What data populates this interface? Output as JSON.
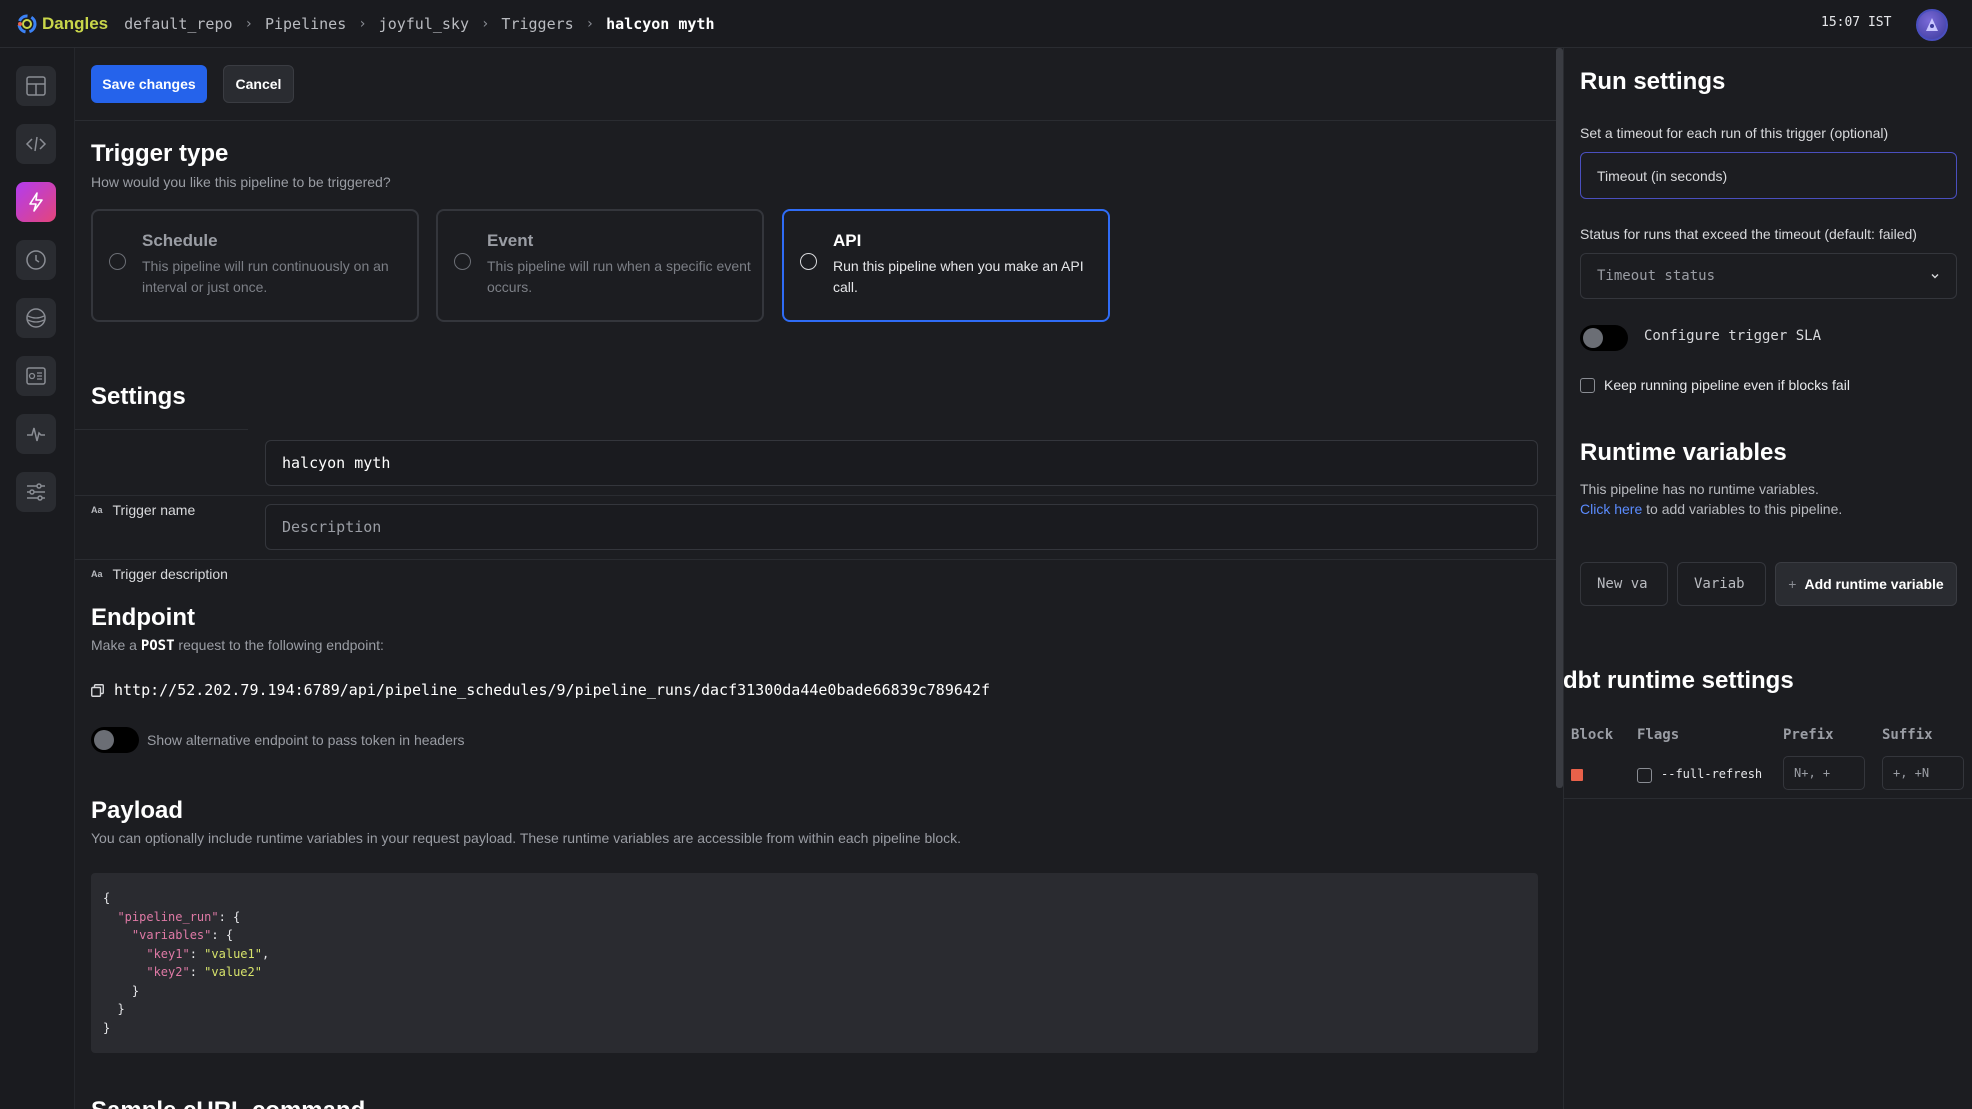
{
  "header": {
    "app_name": "Dangles",
    "breadcrumbs": [
      "default_repo",
      "Pipelines",
      "joyful_sky",
      "Triggers"
    ],
    "current": "halcyon myth",
    "time": "15:07 IST"
  },
  "toolbar": {
    "save_label": "Save changes",
    "cancel_label": "Cancel"
  },
  "trigger_type": {
    "title": "Trigger type",
    "subtitle": "How would you like this pipeline to be triggered?",
    "options": [
      {
        "title": "Schedule",
        "desc": "This pipeline will run continuously on an interval or just once."
      },
      {
        "title": "Event",
        "desc": "This pipeline will run when a specific event occurs."
      },
      {
        "title": "API",
        "desc": "Run this pipeline when you make an API call."
      }
    ],
    "selected": "API"
  },
  "settings": {
    "title": "Settings",
    "name_label": "Trigger name",
    "name_value": "halcyon myth",
    "desc_label": "Trigger description",
    "desc_placeholder": "Description",
    "aa": "Aa"
  },
  "endpoint": {
    "title": "Endpoint",
    "subtitle_pre": "Make a ",
    "method": "POST",
    "subtitle_post": " request to the following endpoint:",
    "url": "http://52.202.79.194:6789/api/pipeline_schedules/9/pipeline_runs/dacf31300da44e0bade66839c789642f",
    "toggle_label": "Show alternative endpoint to pass token in headers"
  },
  "payload": {
    "title": "Payload",
    "subtitle": "You can optionally include runtime variables in your request payload. These runtime variables are accessible from within each pipeline block.",
    "keys": [
      "\"pipeline_run\"",
      "\"variables\"",
      "\"key1\"",
      "\"key2\""
    ],
    "values": [
      "\"value1\"",
      "\"value2\""
    ]
  },
  "curl": {
    "title": "Sample cURL command"
  },
  "run_settings": {
    "title": "Run settings",
    "timeout_label": "Set a timeout for each run of this trigger (optional)",
    "timeout_placeholder": "Timeout (in seconds)",
    "status_label": "Status for runs that exceed the timeout (default: failed)",
    "status_placeholder": "Timeout status",
    "sla_label": "Configure trigger SLA",
    "keep_running_label": "Keep running pipeline even if blocks fail"
  },
  "runtime_variables": {
    "title": "Runtime variables",
    "empty_text": "This pipeline has no runtime variables.",
    "link_text": "Click here",
    "link_suffix": " to add variables to this pipeline.",
    "new_var_placeholder": "New va",
    "var_value_placeholder": "Variab",
    "add_button": "Add runtime variable"
  },
  "dbt": {
    "title": "dbt runtime settings",
    "columns": [
      "Block",
      "Flags",
      "Prefix",
      "Suffix"
    ],
    "row": {
      "block_color": "#e8614a",
      "flag_label": "--full-refresh",
      "prefix_placeholder": "N+, +",
      "suffix_placeholder": "+, +N"
    }
  },
  "colors": {
    "accent": "#2563eb",
    "selected_border": "#2f6cf6",
    "link": "#5b8cff"
  }
}
